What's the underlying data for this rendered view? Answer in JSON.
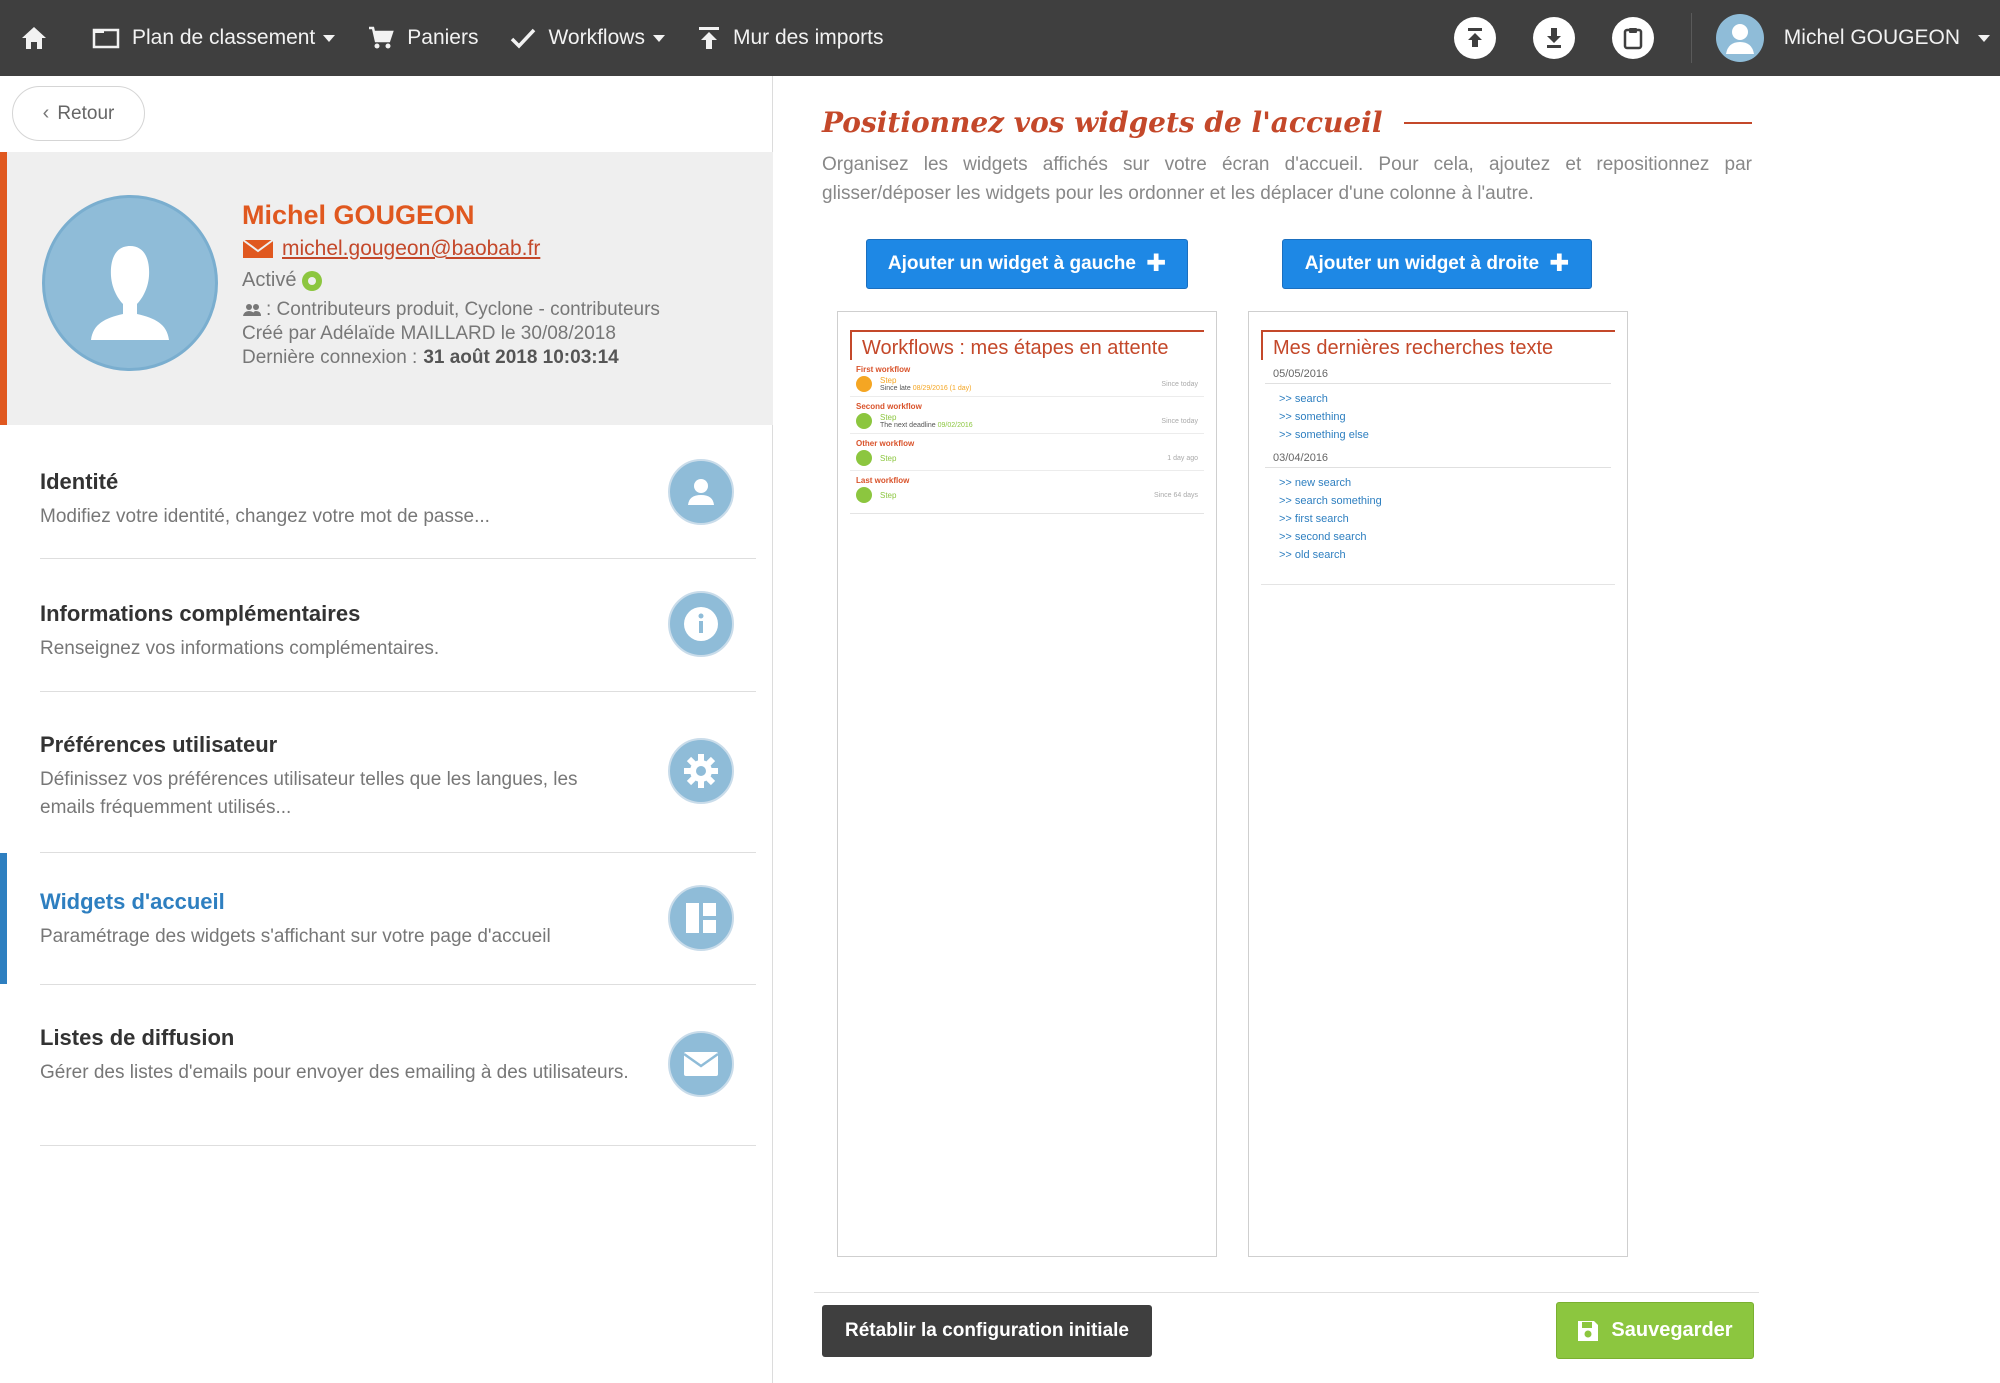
{
  "topbar": {
    "nav": [
      {
        "label": "Plan de classement",
        "icon": "folder-icon",
        "dropdown": true
      },
      {
        "label": "Paniers",
        "icon": "cart-icon",
        "dropdown": false
      },
      {
        "label": "Workflows",
        "icon": "check-icon",
        "dropdown": true
      },
      {
        "label": "Mur des imports",
        "icon": "upload-icon",
        "dropdown": false
      }
    ],
    "user_name": "Michel GOUGEON"
  },
  "left": {
    "back_label": "Retour",
    "profile": {
      "name": "Michel GOUGEON",
      "email": "michel.gougeon@baobab.fr",
      "status": "Activé",
      "groups": ": Contributeurs produit, Cyclone - contributeurs",
      "created": "Créé par Adélaïde MAILLARD le 30/08/2018",
      "last_login_label": "Dernière connexion :",
      "last_login_value": "31 août 2018 10:03:14"
    },
    "menu": [
      {
        "title": "Identité",
        "desc": "Modifiez votre identité, changez votre mot de passe...",
        "icon": "user-icon"
      },
      {
        "title": "Informations complémentaires",
        "desc": "Renseignez vos informations complémentaires.",
        "icon": "info-icon"
      },
      {
        "title": "Préférences utilisateur",
        "desc": "Définissez vos préférences utilisateur telles que les langues, les emails fréquemment utilisés...",
        "icon": "gear-icon"
      },
      {
        "title": "Widgets d'accueil",
        "desc": "Paramétrage des widgets s'affichant sur votre page d'accueil",
        "icon": "widgets-icon",
        "active": true
      },
      {
        "title": "Listes de diffusion",
        "desc": "Gérer des listes d'emails pour envoyer des emailing à des utilisateurs.",
        "icon": "mail-icon"
      }
    ]
  },
  "right": {
    "title": "Positionnez vos widgets de l'accueil",
    "description": "Organisez les widgets affichés sur votre écran d'accueil. Pour cela, ajoutez et repositionnez par glisser/déposer les widgets pour les ordonner et les déplacer d'une colonne à l'autre.",
    "add_left_label": "Ajouter un widget à gauche",
    "add_right_label": "Ajouter un widget à droite",
    "plus": "✚",
    "workflow_widget": {
      "title": "Workflows : mes étapes en attente",
      "items": [
        {
          "name": "First workflow",
          "step": "Step",
          "deadline_label": "Since late",
          "deadline_value": "08/29/2016 (1 day)",
          "since": "Since today",
          "color": "#f5a623",
          "deadline_color": "#f5a623"
        },
        {
          "name": "Second workflow",
          "step": "Step",
          "deadline_label": "The next deadline",
          "deadline_value": "09/02/2016",
          "since": "Since today",
          "color": "#8cc63f",
          "deadline_color": "#8cc63f"
        },
        {
          "name": "Other workflow",
          "step": "Step",
          "deadline_label": "",
          "deadline_value": "",
          "since": "1 day ago",
          "color": "#8cc63f",
          "deadline_color": "#8cc63f"
        },
        {
          "name": "Last workflow",
          "step": "Step",
          "deadline_label": "",
          "deadline_value": "",
          "since": "Since 64 days",
          "color": "#8cc63f",
          "deadline_color": "#8cc63f"
        }
      ]
    },
    "search_widget": {
      "title": "Mes dernières recherches texte",
      "groups": [
        {
          "date": "05/05/2016",
          "links": [
            ">> search",
            ">> something",
            ">> something else"
          ]
        },
        {
          "date": "03/04/2016",
          "links": [
            ">> new search",
            ">> search something",
            ">> first search",
            ">> second search",
            ">> old search"
          ]
        }
      ]
    },
    "reset_label": "Rétablir la configuration initiale",
    "save_label": "Sauvegarder"
  },
  "colors": {
    "topbar": "#3f3f3f",
    "accent_orange": "#e0581f",
    "accent_red": "#c4482a",
    "primary_blue": "#1e88e5",
    "active_blue": "#2e7fc0",
    "success_green": "#8cc63f",
    "icon_blue": "#8fbcd8"
  }
}
